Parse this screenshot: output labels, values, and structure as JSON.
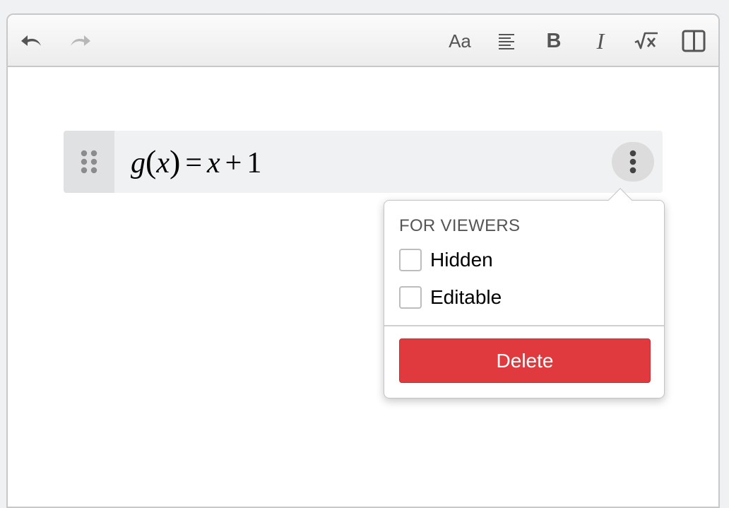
{
  "toolbar": {
    "undo_icon": "undo-icon",
    "redo_icon": "redo-icon",
    "font_label": "Aa",
    "align_icon": "align-left-icon",
    "bold_label": "B",
    "italic_label": "I",
    "math_icon": "square-root-icon",
    "layout_icon": "split-panel-icon"
  },
  "expression": {
    "drag_icon": "drag-handle-icon",
    "func": "g",
    "open_paren": "(",
    "arg": "x",
    "close_paren": ")",
    "equals": "=",
    "rhs_var": "x",
    "plus": "+",
    "constant": "1",
    "more_icon": "vertical-dots-icon"
  },
  "popover": {
    "heading": "FOR VIEWERS",
    "options": [
      {
        "label": "Hidden",
        "checked": false
      },
      {
        "label": "Editable",
        "checked": false
      }
    ],
    "delete_label": "Delete"
  },
  "colors": {
    "delete_bg": "#e0393e",
    "row_bg": "#f0f1f2",
    "icon_gray": "#555555"
  }
}
